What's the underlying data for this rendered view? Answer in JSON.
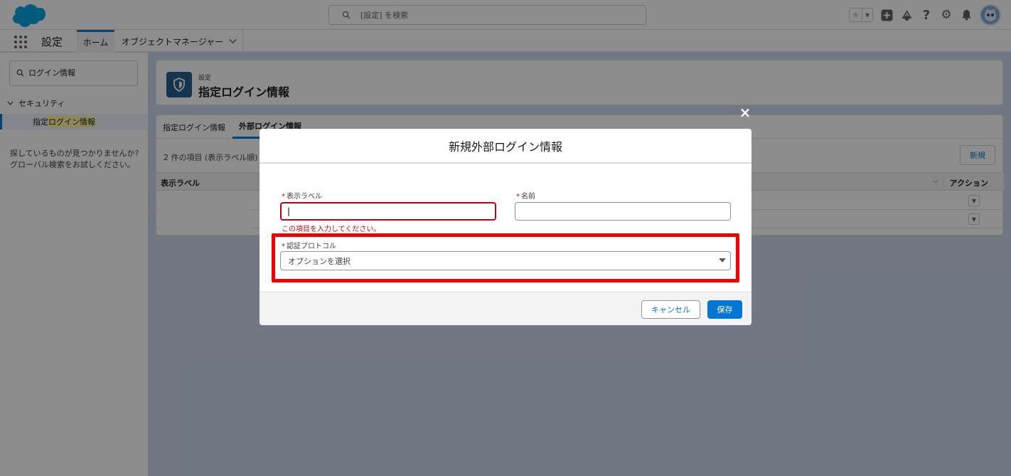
{
  "header": {
    "search_placeholder": "[設定] を検索",
    "icons": [
      "favorites-star-icon",
      "favorites-menu-icon",
      "global-actions-icon",
      "trailhead-icon",
      "help-icon",
      "setup-gear-icon",
      "notifications-bell-icon",
      "user-avatar-icon"
    ]
  },
  "nav": {
    "app_name": "設定",
    "tabs": [
      {
        "label": "ホーム",
        "active": true
      },
      {
        "label": "オブジェクトマネージャー",
        "active": false
      }
    ]
  },
  "sidebar": {
    "search_value": "ログイン情報",
    "section_label": "セキュリティ",
    "item_prefix": "指定",
    "item_highlight": "ログイン情報",
    "help_text": "探しているものが見つかりませんか? グローバル検索をお試しください。"
  },
  "page": {
    "eyebrow": "設定",
    "title": "指定ログイン情報",
    "tabs": [
      {
        "label": "指定ログイン情報",
        "active": false
      },
      {
        "label": "外部ログイン情報",
        "active": true
      }
    ],
    "count_text": "2 件の項目 (表示ラベル順)",
    "new_button": "新規",
    "columns": {
      "label": "表示ラベル",
      "action": "アクション"
    }
  },
  "modal": {
    "title": "新規外部ログイン情報",
    "label_field": {
      "label": "表示ラベル",
      "value": "|",
      "error": "この項目を入力してください。"
    },
    "name_field": {
      "label": "名前",
      "value": ""
    },
    "protocol_field": {
      "label": "認証プロトコル",
      "placeholder": "オプションを選択"
    },
    "cancel": "キャンセル",
    "save": "保存",
    "close_icon": "×"
  },
  "colors": {
    "brand": "#0176d3",
    "error": "#ba0517",
    "annotation": "#f20000"
  }
}
